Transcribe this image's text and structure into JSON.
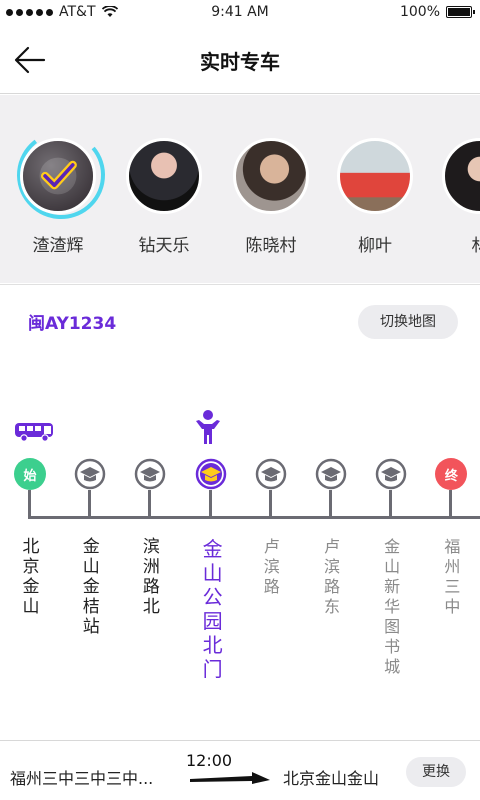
{
  "status_bar": {
    "carrier": "AT&T",
    "time": "9:41 AM",
    "battery": "100%",
    "battery_level": 1.0
  },
  "nav": {
    "title": "实时专车",
    "back_icon": "back-arrow-icon"
  },
  "avatars": [
    {
      "name": "渣渣辉",
      "selected": true
    },
    {
      "name": "钻天乐",
      "selected": false
    },
    {
      "name": "陈晓村",
      "selected": false
    },
    {
      "name": "柳叶",
      "selected": false
    },
    {
      "name": "林",
      "selected": false
    }
  ],
  "route": {
    "plate": "闽AY1234",
    "switch_map_label": "切换地图",
    "bus_icon": "bus-icon",
    "person_icon": "person-icon",
    "colors": {
      "accent": "#6a2bd9",
      "start": "#3ccf8e",
      "end": "#f2545b",
      "track": "#6b6b73",
      "passed_text": "#222222",
      "upcoming_text": "#8a8a8a"
    },
    "stops": [
      {
        "name": "北京金山",
        "badge": "始",
        "kind": "start",
        "status": "passed"
      },
      {
        "name": "金山金桔站",
        "badge": "",
        "kind": "normal",
        "status": "passed"
      },
      {
        "name": "滨洲路北",
        "badge": "",
        "kind": "normal",
        "status": "passed"
      },
      {
        "name": "金山公园北门",
        "badge": "",
        "kind": "current",
        "status": "current"
      },
      {
        "name": "卢滨路",
        "badge": "",
        "kind": "normal",
        "status": "upcoming"
      },
      {
        "name": "卢滨路东",
        "badge": "",
        "kind": "normal",
        "status": "upcoming"
      },
      {
        "name": "金山新华图书城",
        "badge": "",
        "kind": "normal",
        "status": "upcoming"
      },
      {
        "name": "福州三中",
        "badge": "终",
        "kind": "end",
        "status": "upcoming"
      }
    ]
  },
  "bottom": {
    "from": "福州三中三中三中...",
    "time": "12:00",
    "to": "北京金山金山",
    "change_label": "更换"
  }
}
